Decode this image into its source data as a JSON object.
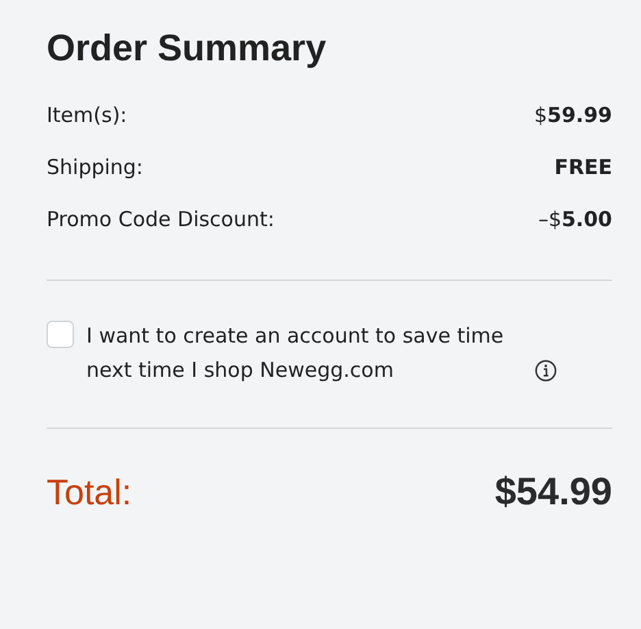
{
  "title": "Order Summary",
  "lines": [
    {
      "label": "Item(s):",
      "value": "$**59.99**"
    },
    {
      "label": "Shipping:",
      "value": "**FREE**"
    },
    {
      "label": "Promo Code Discount:",
      "value": "–$**5.00**"
    }
  ],
  "account_option": {
    "checked": false,
    "label": "I want to create an account to save time next time I shop Newegg.com"
  },
  "total": {
    "label": "Total:",
    "value": "$54.99"
  }
}
